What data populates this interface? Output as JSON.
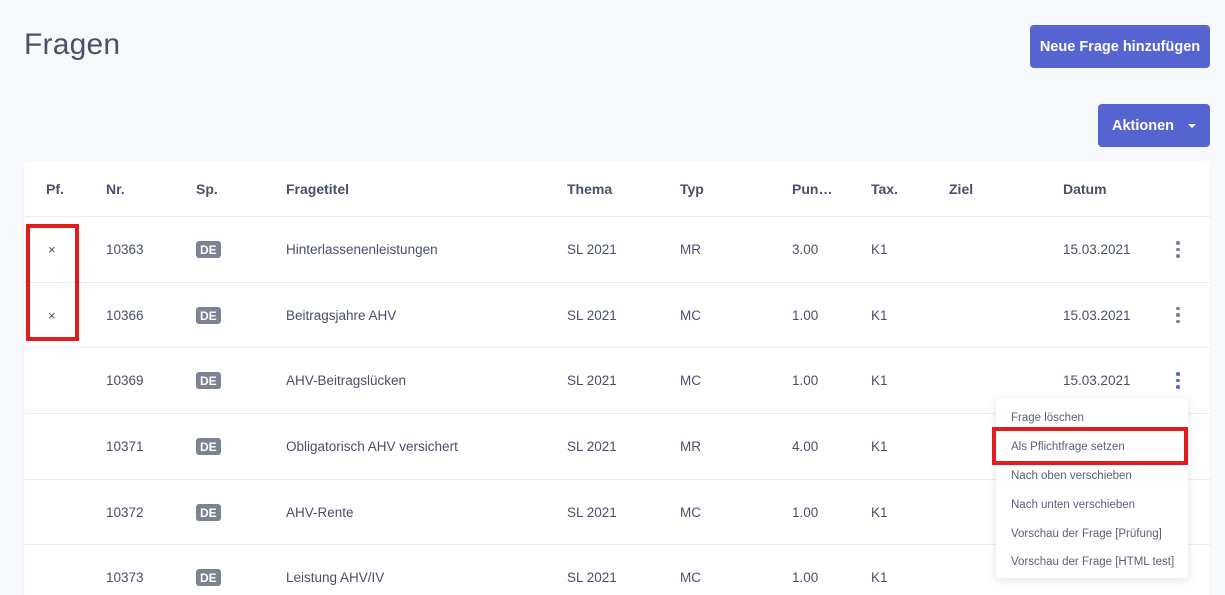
{
  "page": {
    "title": "Fragen"
  },
  "buttons": {
    "new_question": "Neue Frage hinzufügen",
    "actions": "Aktionen"
  },
  "table": {
    "columns": [
      "Pf.",
      "Nr.",
      "Sp.",
      "Fragetitel",
      "Thema",
      "Typ",
      "Pun…",
      "Tax.",
      "Ziel",
      "Datum"
    ],
    "rows": [
      {
        "pf": "×",
        "nr": "10363",
        "sp": "DE",
        "title": "Hinterlassenenleistungen",
        "thema": "SL 2021",
        "typ": "MR",
        "punkte": "3.00",
        "tax": "K1",
        "ziel": "",
        "datum": "15.03.2021"
      },
      {
        "pf": "×",
        "nr": "10366",
        "sp": "DE",
        "title": "Beitragsjahre AHV",
        "thema": "SL 2021",
        "typ": "MC",
        "punkte": "1.00",
        "tax": "K1",
        "ziel": "",
        "datum": "15.03.2021"
      },
      {
        "pf": "",
        "nr": "10369",
        "sp": "DE",
        "title": "AHV-Beitragslücken",
        "thema": "SL 2021",
        "typ": "MC",
        "punkte": "1.00",
        "tax": "K1",
        "ziel": "",
        "datum": "15.03.2021"
      },
      {
        "pf": "",
        "nr": "10371",
        "sp": "DE",
        "title": "Obligatorisch AHV versichert",
        "thema": "SL 2021",
        "typ": "MR",
        "punkte": "4.00",
        "tax": "K1",
        "ziel": "",
        "datum": ""
      },
      {
        "pf": "",
        "nr": "10372",
        "sp": "DE",
        "title": "AHV-Rente",
        "thema": "SL 2021",
        "typ": "MC",
        "punkte": "1.00",
        "tax": "K1",
        "ziel": "",
        "datum": ""
      },
      {
        "pf": "",
        "nr": "10373",
        "sp": "DE",
        "title": "Leistung AHV/IV",
        "thema": "SL 2021",
        "typ": "MC",
        "punkte": "1.00",
        "tax": "K1",
        "ziel": "",
        "datum": ""
      }
    ]
  },
  "row_menu": {
    "items": [
      "Frage löschen",
      "Als Pflichtfrage setzen",
      "Nach oben verschieben",
      "Nach unten verschieben",
      "Vorschau der Frage [Prüfung]",
      "Vorschau der Frage [HTML test]"
    ]
  },
  "colors": {
    "primary": "#5664d2",
    "highlight": "#e31b1b",
    "badge": "#7d8293",
    "background": "#f8f9fc"
  },
  "icons": {
    "row_menu": "kebab-vertical-icon",
    "caret": "caret-down-icon",
    "mandatory": "x-mark-icon"
  }
}
